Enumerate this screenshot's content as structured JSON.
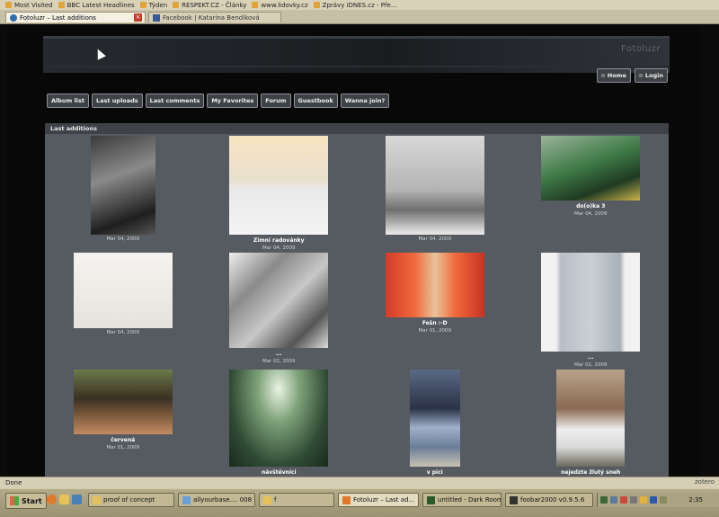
{
  "bookmarks": [
    {
      "label": "Most Visited",
      "color": "#e0a43a"
    },
    {
      "label": "BBC Latest Headlines",
      "color": "#e0a43a"
    },
    {
      "label": "Týden",
      "color": "#e0a43a"
    },
    {
      "label": "RESPEKT.CZ - Články",
      "color": "#e0a43a"
    },
    {
      "label": "www.lidovky.cz",
      "color": "#e0a43a"
    },
    {
      "label": "Zprávy iDNES.cz - Pře...",
      "color": "#e0a43a"
    }
  ],
  "tabs": {
    "active": {
      "label": "Fotoluzr – Last additions",
      "icon": "fotoluzr-favicon"
    },
    "inactive": {
      "label": "Facebook | Katarína Bendíková",
      "icon": "facebook-favicon"
    }
  },
  "site": {
    "title": "Fotoluzr",
    "top_nav": [
      {
        "label": "Home"
      },
      {
        "label": "Login"
      }
    ],
    "main_nav": [
      {
        "label": "Album list"
      },
      {
        "label": "Last uploads"
      },
      {
        "label": "Last comments"
      },
      {
        "label": "My Favorites"
      },
      {
        "label": "Forum"
      },
      {
        "label": "Guestbook"
      },
      {
        "label": "Wanna join?"
      }
    ],
    "section_title": "Last additions"
  },
  "photos": [
    {
      "caption": "",
      "date": "Mar 04, 2009",
      "w": 72,
      "h": 110,
      "bg": "linear-gradient(160deg,#3a3a3a,#8a8a8a 40%,#1e1e1e 80%,#555)"
    },
    {
      "caption": "Zimní radovánky",
      "date": "Mar 04, 2009",
      "w": 110,
      "h": 110,
      "bg": "linear-gradient(180deg,#f7e4c0 0%,#eae0cf 45%,#e9e9ea 55%,#f4f4f6 100%)"
    },
    {
      "caption": "",
      "date": "Mar 04, 2009",
      "w": 110,
      "h": 110,
      "bg": "linear-gradient(180deg,#d8d8d8 0%,#b4b4b4 55%,#6e6e6e 75%,#ececec 100%)"
    },
    {
      "caption": "do(o)ka 3",
      "date": "Mar 04, 2009",
      "w": 110,
      "h": 72,
      "bg": "linear-gradient(160deg,#9ab49a 0%,#3f7a47 45%,#1f3a22 75%,#c8b44a 100%)"
    },
    {
      "caption": "",
      "date": "Mar 04, 2009",
      "w": 110,
      "h": 84,
      "bg": "linear-gradient(180deg,#f5f3ef 0%,#e6e3dd 100%)"
    },
    {
      "caption": "...",
      "date": "Mar 02, 2009",
      "w": 110,
      "h": 106,
      "bg": "linear-gradient(135deg,#eee 0%,#8a8a8a 30%,#c8c8c8 55%,#555 80%,#ddd 100%)"
    },
    {
      "caption": "Fešn :-D",
      "date": "Mar 01, 2009",
      "w": 110,
      "h": 72,
      "bg": "linear-gradient(90deg,#d43a28 0%,#f06b3d 30%,#e9c39a 50%,#f06b3d 70%,#c83222 100%)"
    },
    {
      "caption": "...",
      "date": "Mar 01, 2009",
      "w": 110,
      "h": 110,
      "bg": "linear-gradient(90deg,#f2f2f2 0%,#f2f2f2 15%,#b8bec6 20%,#c9d0d6 50%,#a9b1b9 80%,#f2f2f2 85%)"
    },
    {
      "caption": "červená",
      "date": "Mar 01, 2009",
      "w": 110,
      "h": 72,
      "bg": "linear-gradient(180deg,#6a7a4a 0%,#3b2f22 45%,#7a5a3a 70%,#c48a62 100%)"
    },
    {
      "caption": "návštěvníci",
      "date": "",
      "w": 110,
      "h": 108,
      "bg": "radial-gradient(ellipse at 50% 20%,#eaf4e4 0%,#7fa27a 30%,#2f4a34 70%,#1b2a1d 100%)"
    },
    {
      "caption": "v pici",
      "date": "",
      "w": 56,
      "h": 108,
      "bg": "linear-gradient(180deg,#5b6a84 0%,#2a3247 40%,#9fb1c9 60%,#6a7d98 80%,#c9c2b4 100%)"
    },
    {
      "caption": "nejedzte žlutý sneh",
      "date": "",
      "w": 76,
      "h": 108,
      "bg": "linear-gradient(180deg,#b9a28a 0%,#8a6a52 40%,#eeeeee 62%,#d9d9d9 80%,#6c6a5d 100%)"
    }
  ],
  "status": {
    "text": "Done",
    "addon": "zotero"
  },
  "taskbar": {
    "start_label": "Start",
    "tasks": [
      {
        "label": "proof of concept",
        "icon": "folder-icon",
        "color": "#e6c35a"
      },
      {
        "label": "allyourbase.... 008 - ...",
        "icon": "image-icon",
        "color": "#6aa0d8"
      },
      {
        "label": "f",
        "icon": "folder-icon",
        "color": "#e6c35a"
      },
      {
        "label": "Fotoluzr – Last ad...",
        "icon": "firefox-icon",
        "color": "#e07a2a"
      },
      {
        "label": "untitled - Dark Room",
        "icon": "darkroom-icon",
        "color": "#2a5a2a"
      },
      {
        "label": "foobar2000 v0.9.5.6",
        "icon": "foobar-icon",
        "color": "#333333"
      }
    ],
    "clock": "2:35"
  },
  "colors": {
    "panel": "#565b61",
    "header": "#3f4348",
    "page_bg": "#080808"
  }
}
